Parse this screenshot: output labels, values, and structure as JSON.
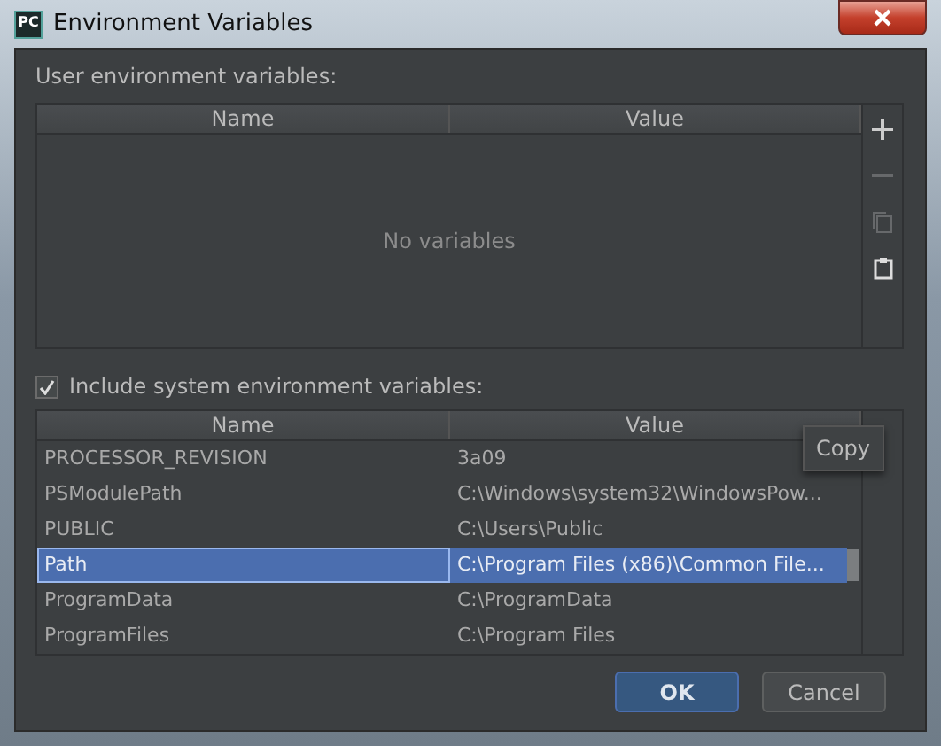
{
  "window": {
    "title": "Environment Variables",
    "app_badge": "PC"
  },
  "user_section": {
    "label": "User environment variables:",
    "columns": [
      "Name",
      "Value"
    ],
    "empty_text": "No variables",
    "tools": [
      {
        "kind": "add",
        "disabled": false
      },
      {
        "kind": "remove",
        "disabled": true
      },
      {
        "kind": "copy",
        "disabled": true
      },
      {
        "kind": "paste",
        "disabled": false
      }
    ]
  },
  "system_section": {
    "label": "Include system environment variables:",
    "checked": true,
    "columns": [
      "Name",
      "Value"
    ],
    "rows": [
      {
        "name": "PROCESSOR_REVISION",
        "value": "3a09",
        "selected": false
      },
      {
        "name": "PSModulePath",
        "value": "C:\\Windows\\system32\\WindowsPow...",
        "selected": false
      },
      {
        "name": "PUBLIC",
        "value": "C:\\Users\\Public",
        "selected": false
      },
      {
        "name": "Path",
        "value": "C:\\Program Files (x86)\\Common File...",
        "selected": true
      },
      {
        "name": "ProgramData",
        "value": "C:\\ProgramData",
        "selected": false
      },
      {
        "name": "ProgramFiles",
        "value": "C:\\Program Files",
        "selected": false
      }
    ],
    "tooltip": "Copy"
  },
  "buttons": [
    {
      "label": "OK",
      "default": true
    },
    {
      "label": "Cancel",
      "default": false
    }
  ]
}
